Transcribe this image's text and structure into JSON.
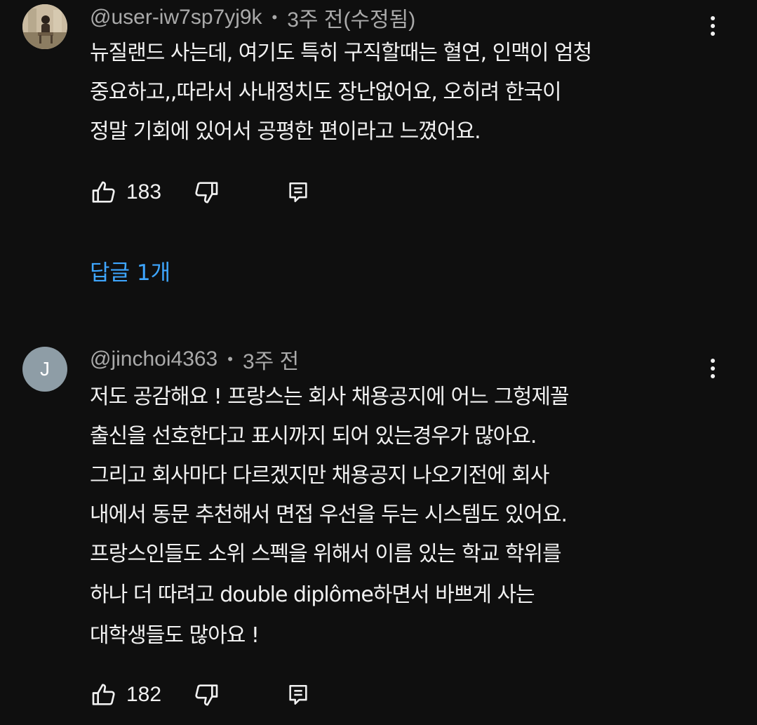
{
  "comments": [
    {
      "author": "@user-iw7sp7yj9k",
      "separator": "•",
      "time": "3주 전(수정됨)",
      "avatar_type": "photo",
      "lines": [
        "뉴질랜드 사는데, 여기도 특히 구직할때는 혈연, 인맥이 엄청",
        "중요하고,,따라서 사내정치도 장난없어요, 오히려 한국이",
        "정말 기회에 있어서 공평한 편이라고 느꼈어요."
      ],
      "likes": "183",
      "replies_label": "답글 1개"
    },
    {
      "author": "@jinchoi4363",
      "separator": "•",
      "time": "3주 전",
      "avatar_letter": "J",
      "avatar_type": "letter",
      "lines": [
        "저도 공감해요 ! 프랑스는 회사 채용공지에 어느 그헝제꼴",
        "출신을 선호한다고 표시까지 되어 있는경우가 많아요.",
        "그리고 회사마다 다르겠지만 채용공지 나오기전에 회사",
        "내에서 동문 추천해서 면접 우선을 두는 시스템도 있어요.",
        "프랑스인들도 소위 스펙을 위해서 이름 있는 학교 학위를",
        "하나 더 따려고 double diplôme하면서 바쁘게 사는",
        "대학생들도 많아요 !"
      ],
      "likes": "182"
    }
  ],
  "icons": {
    "like": "thumbs-up-icon",
    "dislike": "thumbs-down-icon",
    "reply": "reply-comment-icon",
    "more": "more-vertical-icon"
  },
  "colors": {
    "background": "#0f0f0f",
    "text": "#f1f1f1",
    "meta": "#aaaaaa",
    "link": "#3ea6ff"
  }
}
